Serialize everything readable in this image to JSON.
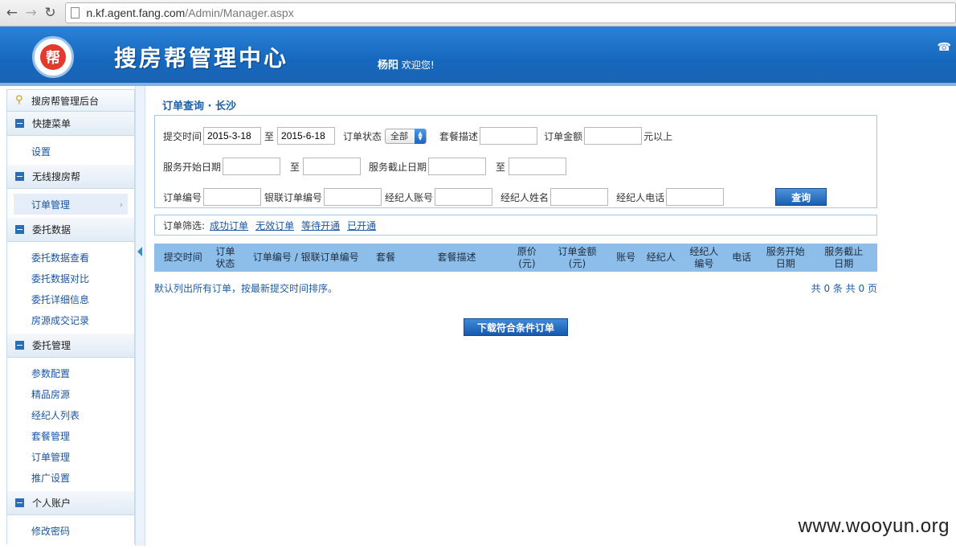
{
  "browser": {
    "url_host": "n.kf.agent.fang.com",
    "url_path": "/Admin/Manager.aspx",
    "back_icon": "back-arrow-icon",
    "forward_icon": "forward-arrow-icon",
    "reload_icon": "reload-icon"
  },
  "header": {
    "logo_text": "帮",
    "title": "搜房帮管理中心",
    "user_name": "杨阳",
    "welcome_text": "欢迎您!",
    "phone_icon": "☎"
  },
  "sidebar": {
    "top_label": "搜房帮管理后台",
    "groups": [
      {
        "title": "快捷菜单",
        "items": [
          "设置"
        ]
      },
      {
        "title": "无线搜房帮",
        "items": [
          "订单管理"
        ]
      },
      {
        "title": "委托数据",
        "items": [
          "委托数据查看",
          "委托数据对比",
          "委托详细信息",
          "房源成交记录"
        ]
      },
      {
        "title": "委托管理",
        "items": [
          "参数配置",
          "精品房源",
          "经纪人列表",
          "套餐管理",
          "订单管理",
          "推广设置"
        ]
      },
      {
        "title": "个人账户",
        "items": [
          "修改密码"
        ]
      }
    ]
  },
  "main": {
    "page_title": "订单查询 · 长沙",
    "search": {
      "submit_time_label": "提交时间",
      "submit_time_from": "2015-3-18",
      "to_label": "至",
      "submit_time_to": "2015-6-18",
      "status_label": "订单状态",
      "status_value": "全部",
      "package_desc_label": "套餐描述",
      "package_desc_value": "",
      "amount_label": "订单金额",
      "amount_value": "",
      "amount_suffix": "元以上",
      "service_start_label": "服务开始日期",
      "service_start_from": "",
      "service_start_to": "",
      "service_end_label": "服务截止日期",
      "service_end_from": "",
      "service_end_to": "",
      "order_no_label": "订单编号",
      "order_no_value": "",
      "unionpay_no_label": "银联订单编号",
      "unionpay_no_value": "",
      "agent_account_label": "经纪人账号",
      "agent_account_value": "",
      "agent_name_label": "经纪人姓名",
      "agent_name_value": "",
      "agent_phone_label": "经纪人电话",
      "agent_phone_value": "",
      "query_button": "查询"
    },
    "filter": {
      "label": "订单筛选:",
      "links": [
        "成功订单",
        "无效订单",
        "等待开通",
        "已开通"
      ]
    },
    "table": {
      "columns": [
        [
          "提交时间"
        ],
        [
          "订单",
          "状态"
        ],
        [
          "订单编号 / 银联订单编号"
        ],
        [
          "套餐"
        ],
        [
          "套餐描述"
        ],
        [
          "原价",
          "(元)"
        ],
        [
          "订单金额",
          "(元)"
        ],
        [
          "账号"
        ],
        [
          "经纪人"
        ],
        [
          "经纪人",
          "编号"
        ],
        [
          "电话"
        ],
        [
          "服务开始",
          "日期"
        ],
        [
          "服务截止",
          "日期"
        ]
      ]
    },
    "info_text": "默认列出所有订单，按最新提交时间排序。",
    "pagination_text": "共 0 条 共 0 页",
    "download_button": "下载符合条件订单"
  },
  "watermark": "www.wooyun.org"
}
